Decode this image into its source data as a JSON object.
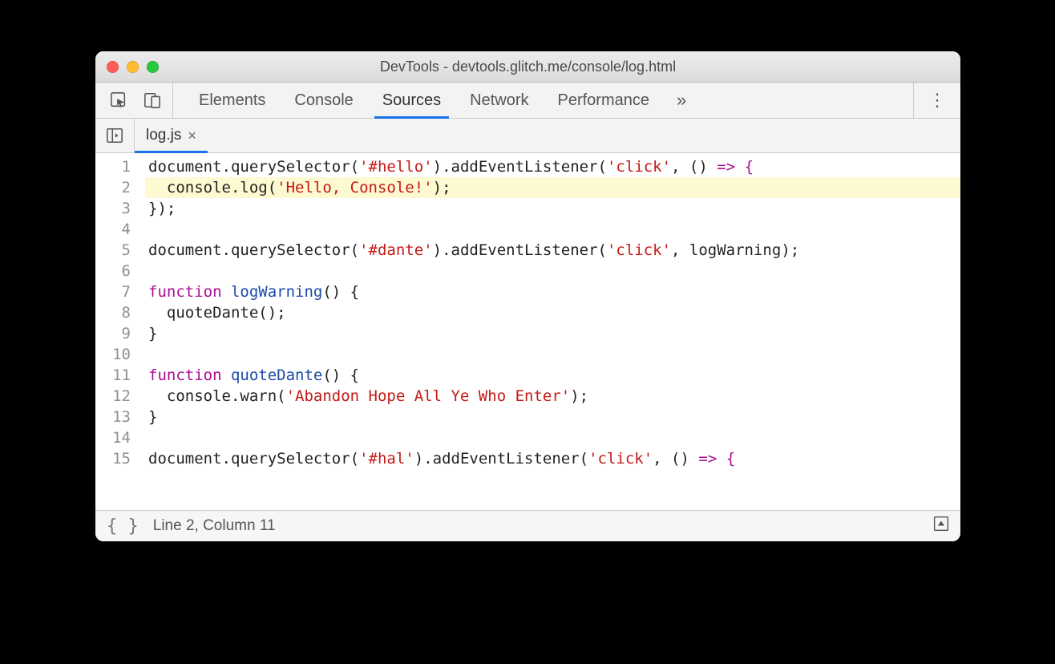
{
  "window": {
    "title": "DevTools - devtools.glitch.me/console/log.html"
  },
  "panels": {
    "elements": "Elements",
    "console": "Console",
    "sources": "Sources",
    "network": "Network",
    "performance": "Performance",
    "more_glyph": "»",
    "menu_glyph": "⋮"
  },
  "file_tab": {
    "name": "log.js",
    "close": "×"
  },
  "code": {
    "lines": [
      [
        {
          "t": "document.querySelector("
        },
        {
          "t": "'#hello'",
          "c": "str"
        },
        {
          "t": ").addEventListener("
        },
        {
          "t": "'click'",
          "c": "str"
        },
        {
          "t": ", () "
        },
        {
          "t": "=> {",
          "c": "kw"
        }
      ],
      [
        {
          "t": "  console.log("
        },
        {
          "t": "'Hello, Console!'",
          "c": "str"
        },
        {
          "t": ");"
        }
      ],
      [
        {
          "t": "});"
        }
      ],
      [
        {
          "t": ""
        }
      ],
      [
        {
          "t": "document.querySelector("
        },
        {
          "t": "'#dante'",
          "c": "str"
        },
        {
          "t": ").addEventListener("
        },
        {
          "t": "'click'",
          "c": "str"
        },
        {
          "t": ", logWarning);"
        }
      ],
      [
        {
          "t": ""
        }
      ],
      [
        {
          "t": "function ",
          "c": "kw"
        },
        {
          "t": "logWarning",
          "c": "def"
        },
        {
          "t": "() {"
        }
      ],
      [
        {
          "t": "  quoteDante();"
        }
      ],
      [
        {
          "t": "}"
        }
      ],
      [
        {
          "t": ""
        }
      ],
      [
        {
          "t": "function ",
          "c": "kw"
        },
        {
          "t": "quoteDante",
          "c": "def"
        },
        {
          "t": "() {"
        }
      ],
      [
        {
          "t": "  console.warn("
        },
        {
          "t": "'Abandon Hope All Ye Who Enter'",
          "c": "str"
        },
        {
          "t": ");"
        }
      ],
      [
        {
          "t": "}"
        }
      ],
      [
        {
          "t": ""
        }
      ],
      [
        {
          "t": "document.querySelector("
        },
        {
          "t": "'#hal'",
          "c": "str"
        },
        {
          "t": ").addEventListener("
        },
        {
          "t": "'click'",
          "c": "str"
        },
        {
          "t": ", () "
        },
        {
          "t": "=> {",
          "c": "kw"
        }
      ]
    ],
    "highlight_index": 1
  },
  "status": {
    "braces": "{ }",
    "position": "Line 2, Column 11"
  }
}
